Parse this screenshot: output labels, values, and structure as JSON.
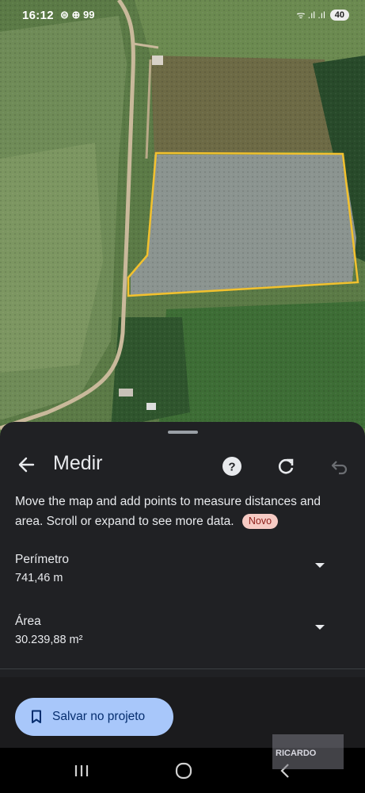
{
  "status_bar": {
    "time": "16:12",
    "left_icons": "⊜ ⊕ 99",
    "right_icons": "ᯤ .ıl .ıl",
    "battery": "40"
  },
  "map": {
    "measured_area_outline_color": "#f2c12e"
  },
  "sheet": {
    "title": "Medir",
    "description": "Move the map and add points to measure distances and area. Scroll or expand to see more data.",
    "badge": "Novo",
    "perimeter": {
      "label": "Perímetro",
      "value": "741,46 m"
    },
    "area": {
      "label": "Área",
      "value": "30.239,88 m²"
    },
    "save_button": "Salvar no projeto",
    "icons": {
      "back": "back-arrow-icon",
      "help": "help-icon",
      "refresh": "refresh-icon",
      "undo": "undo-icon"
    }
  },
  "watermark": "RICARDO",
  "colors": {
    "sheet_bg": "#202124",
    "button_bg": "#a8c7fa",
    "badge_bg": "#f6cbc4"
  }
}
